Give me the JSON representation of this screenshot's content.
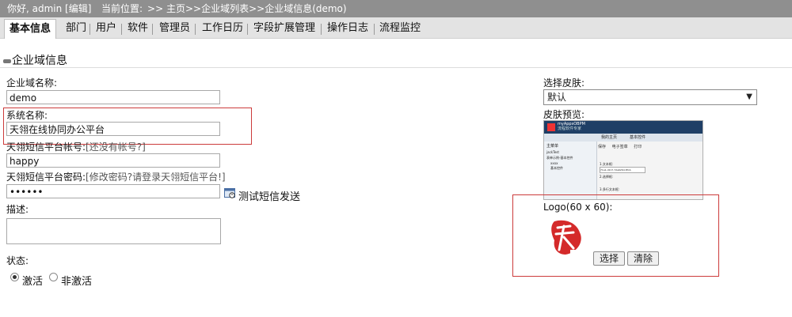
{
  "topbar": {
    "greeting": "你好, admin [编辑]",
    "location_label": "当前位置:",
    "breadcrumb": ">> 主页>>企业域列表>>企业域信息(demo)"
  },
  "tabs": [
    {
      "label": "基本信息",
      "active": true
    },
    {
      "label": "部门"
    },
    {
      "label": "用户"
    },
    {
      "label": "软件"
    },
    {
      "label": "管理员"
    },
    {
      "label": "工作日历"
    },
    {
      "label": "字段扩展管理"
    },
    {
      "label": "操作日志"
    },
    {
      "label": "流程监控"
    }
  ],
  "section_title": "企业域信息",
  "form": {
    "domain_name_label": "企业域名称:",
    "domain_name_value": "demo",
    "system_name_label": "系统名称:",
    "system_name_value": "天翎在线协同办公平台",
    "sms_account_label": "天翎短信平台帐号:",
    "sms_account_link": "[还没有帐号?]",
    "sms_account_value": "happy",
    "sms_password_label": "天翎短信平台密码:",
    "sms_password_link": "[修改密码?请登录天翎短信平台!]",
    "sms_password_value": "••••••",
    "sms_test_label": "测试短信发送",
    "description_label": "描述:",
    "status_label": "状态:",
    "status_active": "激活",
    "status_inactive": "非激活"
  },
  "skin": {
    "select_label": "选择皮肤:",
    "selected": "默认",
    "preview_label": "皮肤预览:",
    "preview": {
      "brand": "myAppsOBPM",
      "brand_sub": "流程软件专家",
      "tab1": "我的主页",
      "tab2": "基本控件",
      "menu_head": "主菜单",
      "menu_items": [
        "jackTest",
        "表单示例-基本控件",
        "xxxx",
        "基本控件"
      ],
      "tool_save": "保存",
      "tool_sign": "电子签章",
      "tool_print": "打印",
      "field1": "1.文本框:",
      "field1_value": "71a1-d217-72a626d-8fc4-",
      "field2": "2.选择框:",
      "field3": "3.多行文本框:"
    }
  },
  "logo": {
    "label": "Logo(60 x 60):",
    "choose": "选择",
    "clear": "清除"
  },
  "colors": {
    "topbar_bg": "#8f8f8f",
    "highlight_border": "#cc3b3b",
    "logo_red": "#d42a2a"
  }
}
